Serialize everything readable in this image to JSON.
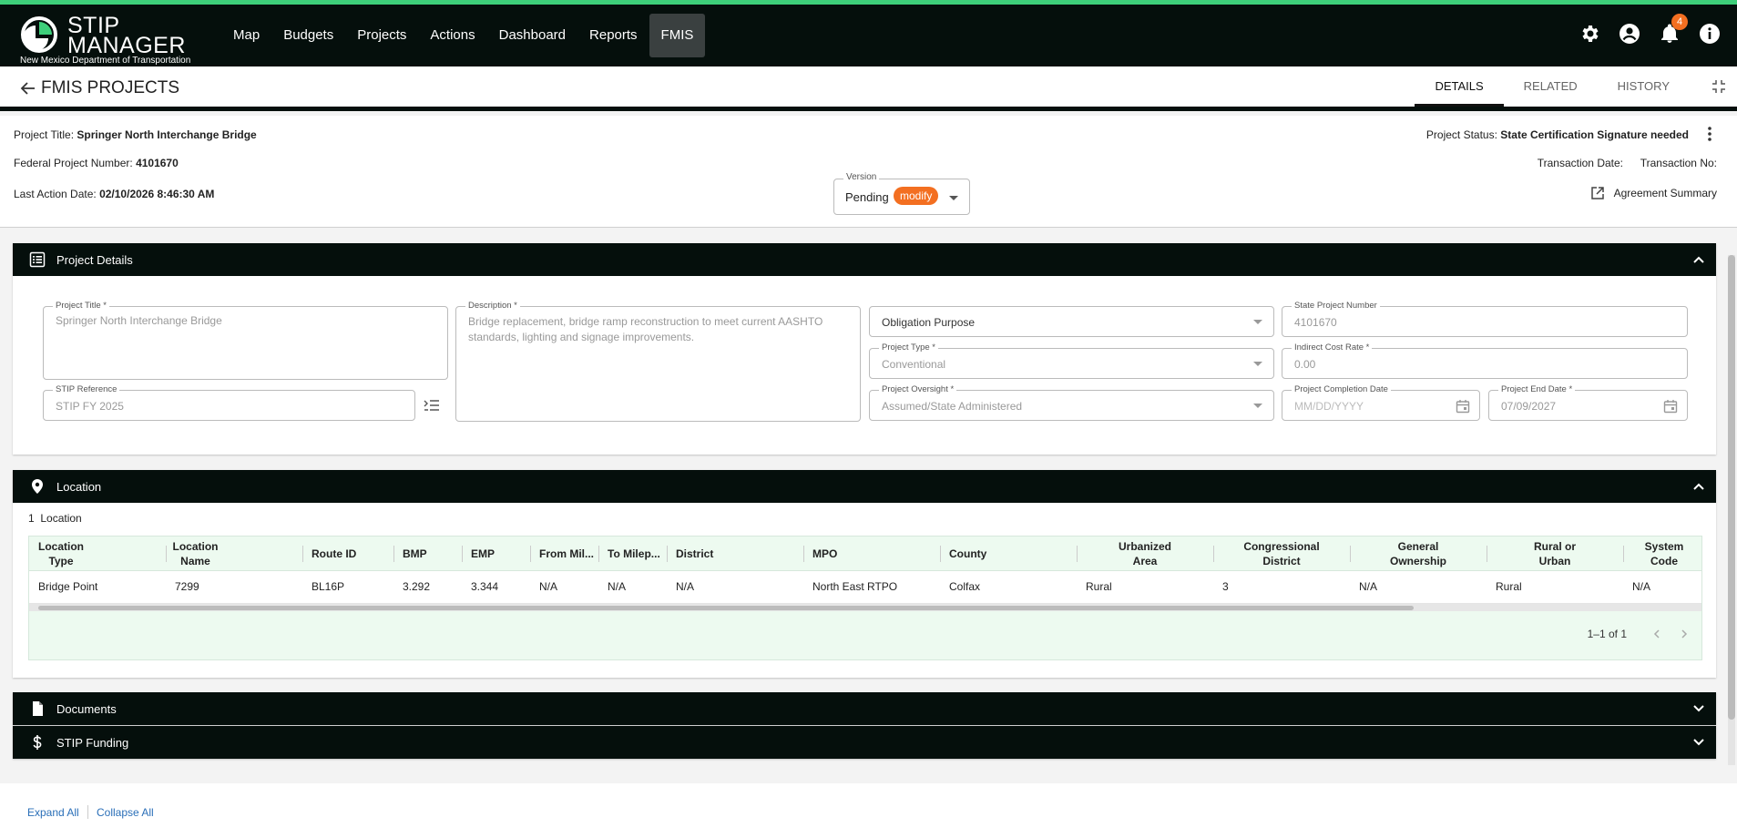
{
  "app": {
    "logo_title": "STIP MANAGER",
    "logo_line1": "STIP",
    "logo_line2": "MANAGER",
    "logo_sub": "New Mexico Department of Transportation"
  },
  "nav": {
    "items": [
      "Map",
      "Budgets",
      "Projects",
      "Actions",
      "Dashboard",
      "Reports",
      "FMIS"
    ],
    "active": "FMIS"
  },
  "notifications": {
    "count": "4"
  },
  "subheader": {
    "title": "FMIS PROJECTS",
    "tabs": [
      "DETAILS",
      "RELATED",
      "HISTORY"
    ],
    "active_tab": "DETAILS"
  },
  "header_info": {
    "project_title_label": "Project Title:",
    "project_title_value": "Springer North Interchange Bridge",
    "federal_number_label": "Federal Project Number:",
    "federal_number_value": "4101670",
    "last_action_label": "Last Action Date:",
    "last_action_value": "02/10/2026 8:46:30 AM",
    "status_label": "Project Status:",
    "status_value": "State Certification Signature needed",
    "transaction_date_label": "Transaction Date:",
    "transaction_no_label": "Transaction No:",
    "agreement_summary": "Agreement Summary",
    "version": {
      "label": "Version",
      "value": "Pending",
      "pill": "modify"
    }
  },
  "project_details": {
    "heading": "Project Details",
    "project_title": {
      "label": "Project Title *",
      "value": "Springer North Interchange Bridge"
    },
    "description": {
      "label": "Description *",
      "value": "Bridge replacement, bridge ramp reconstruction to meet current AASHTO standards, lighting and signage improvements."
    },
    "obligation_purpose": {
      "value": "Obligation Purpose"
    },
    "state_project_number": {
      "label": "State Project Number",
      "value": "4101670"
    },
    "project_type": {
      "label": "Project Type *",
      "value": "Conventional"
    },
    "indirect_cost_rate": {
      "label": "Indirect Cost Rate *",
      "value": "0.00"
    },
    "stip_reference": {
      "label": "STIP Reference",
      "value": "STIP FY 2025"
    },
    "project_oversight": {
      "label": "Project Oversight *",
      "value": "Assumed/State Administered"
    },
    "completion_date": {
      "label": "Project Completion Date",
      "placeholder": "MM/DD/YYYY"
    },
    "end_date": {
      "label": "Project End Date *",
      "value": "07/09/2027"
    }
  },
  "location": {
    "heading": "Location",
    "count": "1",
    "count_label": "Location",
    "columns": [
      [
        "Location",
        "Type"
      ],
      [
        "Location",
        "Name"
      ],
      [
        "Route ID"
      ],
      [
        "BMP"
      ],
      [
        "EMP"
      ],
      [
        "From Mil..."
      ],
      [
        "To Milep..."
      ],
      [
        "District"
      ],
      [
        "MPO"
      ],
      [
        "County"
      ],
      [
        "Urbanized",
        "Area"
      ],
      [
        "Congressional",
        "District"
      ],
      [
        "General",
        "Ownership"
      ],
      [
        "Rural or",
        "Urban"
      ],
      [
        "System",
        "Code"
      ]
    ],
    "rows": [
      [
        "Bridge Point",
        "7299",
        "BL16P",
        "3.292",
        "3.344",
        "N/A",
        "N/A",
        "N/A",
        "North East RTPO",
        "Colfax",
        "Rural",
        "3",
        "N/A",
        "Rural",
        "N/A"
      ]
    ],
    "pagination": "1–1 of 1"
  },
  "documents": {
    "heading": "Documents"
  },
  "stip_funding": {
    "heading": "STIP Funding"
  },
  "footer": {
    "expand_all": "Expand All",
    "collapse_all": "Collapse All"
  }
}
